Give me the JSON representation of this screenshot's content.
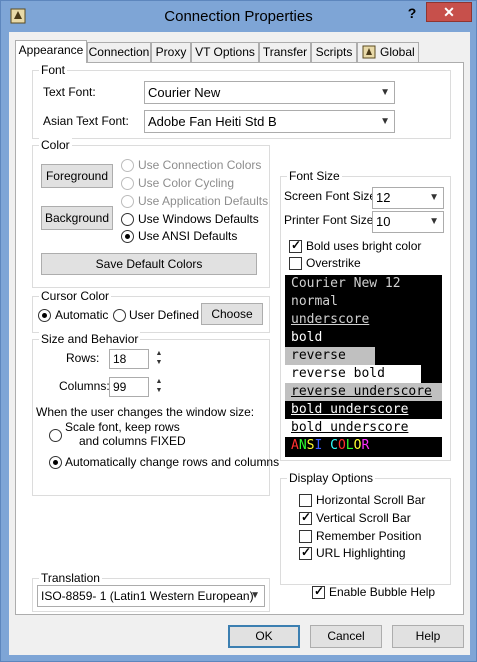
{
  "window": {
    "title": "Connection Properties",
    "help_glyph": "?",
    "close_glyph": "✕"
  },
  "tabs": [
    {
      "label": "Appearance"
    },
    {
      "label": "Connection"
    },
    {
      "label": "Proxy"
    },
    {
      "label": "VT Options"
    },
    {
      "label": "Transfer"
    },
    {
      "label": "Scripts"
    },
    {
      "label": "Global"
    }
  ],
  "font": {
    "group_label": "Font",
    "text_font_label": "Text Font:",
    "text_font_value": "Courier New",
    "asian_font_label": "Asian Text Font:",
    "asian_font_value": "Adobe Fan Heiti Std B"
  },
  "color": {
    "group_label": "Color",
    "foreground_btn": "Foreground",
    "background_btn": "Background",
    "options": [
      {
        "label": "Use Connection Colors",
        "enabled": false,
        "selected": false
      },
      {
        "label": "Use Color Cycling",
        "enabled": false,
        "selected": false
      },
      {
        "label": "Use Application Defaults",
        "enabled": false,
        "selected": false
      },
      {
        "label": "Use Windows Defaults",
        "enabled": true,
        "selected": false
      },
      {
        "label": "Use ANSI Defaults",
        "enabled": true,
        "selected": true
      }
    ],
    "save_btn": "Save Default Colors"
  },
  "cursor": {
    "group_label": "Cursor Color",
    "automatic": "Automatic",
    "user_defined": "User Defined",
    "choose_btn": "Choose",
    "selected": "automatic"
  },
  "size": {
    "group_label": "Size and Behavior",
    "rows_label": "Rows:",
    "rows_value": "18",
    "cols_label": "Columns:",
    "cols_value": "99",
    "when_label": "When the user changes the window size:",
    "scale_line1": "Scale font, keep rows",
    "scale_line2": "and columns FIXED",
    "auto_label": "Automatically change rows and columns",
    "selected": "auto"
  },
  "fontsize": {
    "group_label": "Font Size",
    "screen_label": "Screen Font Size",
    "screen_value": "12",
    "printer_label": "Printer Font Size",
    "printer_value": "10",
    "bold_bright": "Bold uses bright color",
    "bold_bright_checked": true,
    "overstrike": "Overstrike",
    "overstrike_checked": false
  },
  "preview": {
    "lines": [
      {
        "text": "Courier New 12",
        "style": "normal"
      },
      {
        "text": "normal",
        "style": "normal"
      },
      {
        "text": "underscore ",
        "style": "underscore"
      },
      {
        "text": "bold",
        "style": "bold"
      },
      {
        "text": "reverse",
        "style": "reverse"
      },
      {
        "text": "reverse bold",
        "style": "reverse-bold"
      },
      {
        "text": "reverse underscore",
        "style": "reverse-underscore"
      },
      {
        "text": "bold underscore",
        "style": "bold-underscore"
      },
      {
        "text": "bold underscore",
        "style": "reverse-bold-underscore"
      },
      {
        "text": "ANSI COLOR",
        "style": "ansi"
      }
    ],
    "ansi_colors": [
      "#ff3030",
      "#30ff30",
      "#ffff30",
      "#3a5bff",
      "#ff30ff",
      "#30ffff",
      "#ff3030",
      "#30ff30",
      "#ffff30",
      "#ff30ff"
    ]
  },
  "display": {
    "group_label": "Display Options",
    "items": [
      {
        "label": "Horizontal Scroll Bar",
        "checked": false
      },
      {
        "label": "Vertical Scroll Bar",
        "checked": true
      },
      {
        "label": "Remember Position",
        "checked": false
      },
      {
        "label": "URL Highlighting",
        "checked": true
      }
    ]
  },
  "translation": {
    "group_label": "Translation",
    "value": "ISO-8859- 1 (Latin1 Western European)"
  },
  "bubble_help": {
    "label": "Enable Bubble Help",
    "checked": true
  },
  "footer": {
    "ok": "OK",
    "cancel": "Cancel",
    "help": "Help"
  },
  "colors": {
    "accent": "#3c7fb1",
    "titlebar": "#7ea5d6",
    "close": "#c7504b"
  }
}
